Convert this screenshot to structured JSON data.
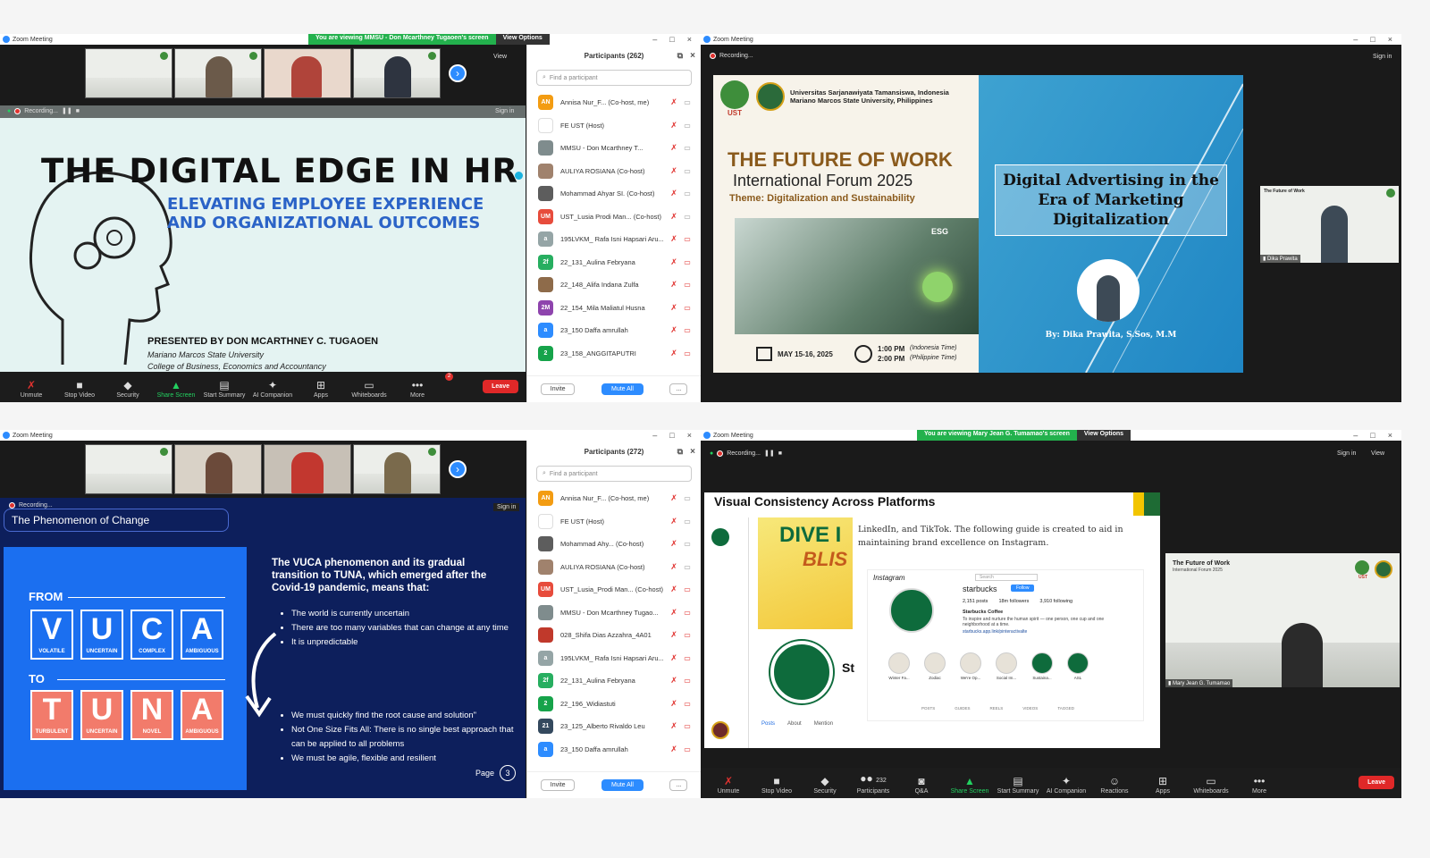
{
  "window_title": "Zoom Meeting",
  "q1": {
    "banner_text": "You are viewing MMSU - Don Mcarthney Tugaoen's screen",
    "view_options": "View Options",
    "view_label": "View",
    "recording": "Recording...",
    "sign_in": "Sign in",
    "slide": {
      "title": "THE DIGITAL EDGE IN HR",
      "subtitle1": "ELEVATING EMPLOYEE EXPERIENCE",
      "subtitle2": "AND ORGANIZATIONAL OUTCOMES",
      "presenter": "PRESENTED BY DON MCARTHNEY C. TUGAOEN",
      "university": "Mariano Marcos State University",
      "college": "College of Business, Economics and Accountancy"
    },
    "toolbar": [
      "Unmute",
      "Stop Video",
      "Security",
      "Share Screen",
      "Start Summary",
      "AI Companion",
      "Apps",
      "Whiteboards",
      "More"
    ],
    "more_badge": "2",
    "leave": "Leave",
    "participants": {
      "title": "Participants (262)",
      "search_placeholder": "Find a participant",
      "rows": [
        {
          "initials": "AN",
          "color": "#f39c12",
          "name": "Annisa Nur_F... (Co-host, me)",
          "cam": "on"
        },
        {
          "initials": "",
          "color": "#ffffff",
          "name": "FE UST (Host)",
          "cam": "on"
        },
        {
          "initials": "",
          "color": "#7f8c8d",
          "name": "MMSU - Don Mcarthney T...",
          "cam": "on"
        },
        {
          "initials": "",
          "color": "#a0826d",
          "name": "AULIYA ROSIANA (Co-host)",
          "cam": "on"
        },
        {
          "initials": "",
          "color": "#5d5d5d",
          "name": "Mohammad Ahyar SI. (Co-host)",
          "cam": "on"
        },
        {
          "initials": "UM",
          "color": "#e74c3c",
          "name": "UST_Lusia Prodi Man... (Co-host)",
          "cam": "on"
        },
        {
          "initials": "a",
          "color": "#95a5a6",
          "name": "195LVKM_ Rafa Isni Hapsari Aru...",
          "cam": "off"
        },
        {
          "initials": "2f",
          "color": "#27ae60",
          "name": "22_131_Aulina Febryana",
          "cam": "off"
        },
        {
          "initials": "",
          "color": "#8e6b4a",
          "name": "22_148_Alifa Indana Zulfa",
          "cam": "off"
        },
        {
          "initials": "2M",
          "color": "#8e44ad",
          "name": "22_154_Mila Maliatul Husna",
          "cam": "off"
        },
        {
          "initials": "a",
          "color": "#2d8cff",
          "name": "23_150 Daffa amrullah",
          "cam": "off"
        },
        {
          "initials": "2",
          "color": "#16a34a",
          "name": "23_158_ANGGITAPUTRI",
          "cam": "off"
        }
      ],
      "invite": "Invite",
      "mute_all": "Mute All",
      "more": "..."
    }
  },
  "q2": {
    "recording": "Recording...",
    "sign_in": "Sign in",
    "poster": {
      "uni1": "Universitas Sarjanawiyata Tamansiswa, Indonesia",
      "uni2": "Mariano Marcos State University, Philippines",
      "ust": "UST",
      "title": "THE FUTURE OF WORK",
      "forum": "International Forum 2025",
      "theme": "Theme: Digitalization and Sustainability",
      "esg": "ESG",
      "date": "MAY 15-16, 2025",
      "time1": "1:00 PM",
      "tz1": "(Indonesia Time)",
      "time2": "2:00 PM",
      "tz2": "(Philippine Time)",
      "talk": "Digital Advertising in the Era of Marketing Digitalization",
      "by": "By: Dika Prawita, S.Sos, M.M"
    },
    "speaker_name": "Dika Prawita",
    "thumb_title": "The Future of Work"
  },
  "q3": {
    "recording": "Recording...",
    "sign_in": "Sign in",
    "slide_heading": "The Phenomenon of Change",
    "from": "FROM",
    "to": "TO",
    "vuca": [
      {
        "l": "V",
        "w": "VOLATILE"
      },
      {
        "l": "U",
        "w": "UNCERTAIN"
      },
      {
        "l": "C",
        "w": "COMPLEX"
      },
      {
        "l": "A",
        "w": "AMBIGUOUS"
      }
    ],
    "tuna": [
      {
        "l": "T",
        "w": "TURBULENT"
      },
      {
        "l": "U",
        "w": "UNCERTAIN"
      },
      {
        "l": "N",
        "w": "NOVEL"
      },
      {
        "l": "A",
        "w": "AMBIGUOUS"
      }
    ],
    "intro": "The VUCA phenomenon and its gradual transition to TUNA, which emerged after the Covid-19 pandemic, means that:",
    "bullets1": [
      "The world is currently uncertain",
      "There are too many variables that can change at any time",
      "It is unpredictable"
    ],
    "bullets2": [
      "We must quickly find the root cause and solution\"",
      "Not One Size Fits All: There is no single best approach that can be applied to all problems",
      "We must be agile, flexible and resilient"
    ],
    "page_label": "Page",
    "page_num": "3",
    "participants": {
      "title": "Participants (272)",
      "search_placeholder": "Find a participant",
      "rows": [
        {
          "initials": "AN",
          "color": "#f39c12",
          "name": "Annisa Nur_F... (Co-host, me)",
          "cam": "on"
        },
        {
          "initials": "",
          "color": "#ffffff",
          "name": "FE UST (Host)",
          "cam": "on"
        },
        {
          "initials": "",
          "color": "#5d5d5d",
          "name": "Mohammad Ahy... (Co-host)",
          "cam": "on"
        },
        {
          "initials": "",
          "color": "#a0826d",
          "name": "AULIYA ROSIANA (Co-host)",
          "cam": "on"
        },
        {
          "initials": "UM",
          "color": "#e74c3c",
          "name": "UST_Lusia_Prodi Man... (Co-host)",
          "cam": "off"
        },
        {
          "initials": "",
          "color": "#7f8c8d",
          "name": "MMSU - Don Mcarthney Tugao...",
          "cam": "off"
        },
        {
          "initials": "",
          "color": "#c0392b",
          "name": "028_Shifa Dias Azzahra_4A01",
          "cam": "off"
        },
        {
          "initials": "a",
          "color": "#95a5a6",
          "name": "195LVKM_ Rafa Isni Hapsari Aru...",
          "cam": "off"
        },
        {
          "initials": "2f",
          "color": "#27ae60",
          "name": "22_131_Aulina Febryana",
          "cam": "off"
        },
        {
          "initials": "2",
          "color": "#16a34a",
          "name": "22_196_Widiastuti",
          "cam": "off"
        },
        {
          "initials": "21",
          "color": "#34495e",
          "name": "23_125_Alberto Rivaldo Leu",
          "cam": "off"
        },
        {
          "initials": "a",
          "color": "#2d8cff",
          "name": "23_150 Daffa amrullah",
          "cam": "off"
        }
      ],
      "invite": "Invite",
      "mute_all": "Mute All",
      "more": "..."
    }
  },
  "q4": {
    "banner_text": "You are viewing Mary Jean G. Tumamao's screen",
    "view_options": "View Options",
    "recording": "Recording...",
    "sign_in": "Sign in",
    "view_label": "View",
    "slide_title": "Visual Consistency Across Platforms",
    "dive": "DIVE I",
    "blis": "BLIS",
    "body": "LinkedIn, and TikTok. The following guide is created to aid in maintaining brand excellence on Instagram.",
    "insta_label": "Instagram",
    "insta_search": "Search",
    "handle": "starbucks",
    "follow": "Follow",
    "stats": [
      "2,151 posts",
      "18m followers",
      "3,910 following"
    ],
    "bio_name": "Starbucks Coffee",
    "bio_text": "To inspire and nurture the human spirit — one person, one cup and one neighborhood at a time.",
    "bio_link": "starbucks.app.link/pinteractivalte",
    "highlights": [
      "Winter Fa...",
      "Zodiac",
      "We're Op...",
      "Social Im...",
      "Sustaina...",
      "ASL"
    ],
    "tabs": [
      "POSTS",
      "GUIDES",
      "REELS",
      "VIDEOS",
      "TAGGED"
    ],
    "left_tabs": [
      "Posts",
      "About",
      "Mention"
    ],
    "st_text": "St",
    "thumb_title": "The Future of Work",
    "thumb_sub": "International Forum 2025",
    "ust": "UST",
    "speaker_name": "Mary Jean G. Tumamao",
    "participants_count": "232",
    "toolbar": [
      "Unmute",
      "Stop Video",
      "Security",
      "Participants",
      "Q&A",
      "Share Screen",
      "Start Summary",
      "AI Companion",
      "Reactions",
      "Apps",
      "Whiteboards",
      "More"
    ],
    "leave": "Leave"
  }
}
